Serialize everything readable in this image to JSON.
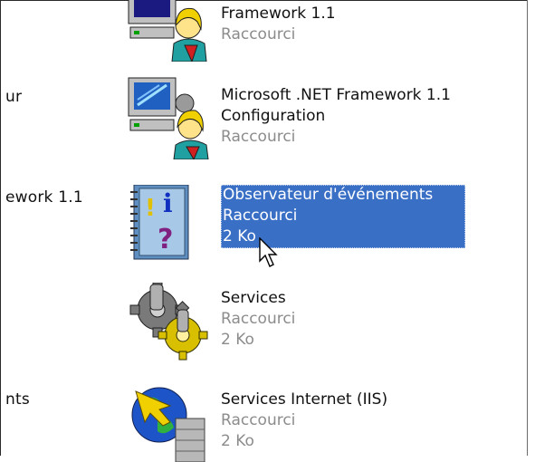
{
  "left_column": [
    {
      "text": "ur"
    },
    {
      "text": "ework 1.1"
    },
    {
      "text": "nts"
    }
  ],
  "items": [
    {
      "name": "Framework 1.1",
      "type": "Raccourci",
      "size": "",
      "icon": "net-framework-icon"
    },
    {
      "name": "Microsoft .NET Framework 1.1",
      "name2": "Configuration",
      "type": "Raccourci",
      "size": "",
      "icon": "net-framework-config-icon"
    },
    {
      "name": "Observateur d'événements",
      "type": "Raccourci",
      "size": "2 Ko",
      "icon": "event-viewer-icon",
      "selected": true
    },
    {
      "name": "Services",
      "type": "Raccourci",
      "size": "2 Ko",
      "icon": "services-gears-icon"
    },
    {
      "name": "Services Internet (IIS)",
      "type": "Raccourci",
      "size": "2 Ko",
      "icon": "iis-globe-icon"
    }
  ],
  "colors": {
    "selection": "#3a6fc6",
    "secondary_text": "#8c8c8c"
  }
}
